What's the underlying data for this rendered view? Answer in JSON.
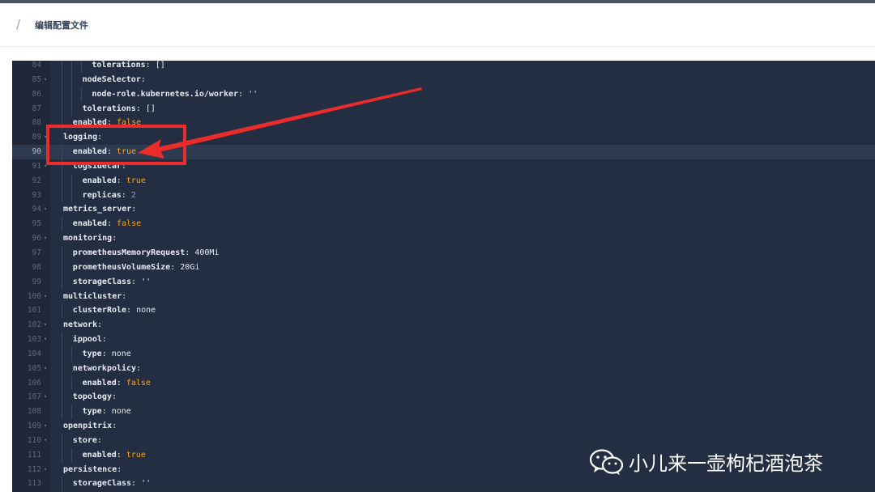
{
  "header": {
    "title": "编辑配置文件"
  },
  "editor": {
    "active_line": 90,
    "lines": [
      {
        "n": "84",
        "fold": false,
        "indent": 3,
        "key": "tolerations",
        "val": "[]",
        "vt": "str"
      },
      {
        "n": "85",
        "fold": true,
        "indent": 2,
        "key": "nodeSelector",
        "val": "",
        "vt": "none"
      },
      {
        "n": "86",
        "fold": false,
        "indent": 3,
        "key": "node-role.kubernetes.io/worker",
        "val": "''",
        "vt": "str"
      },
      {
        "n": "87",
        "fold": false,
        "indent": 2,
        "key": "tolerations",
        "val": "[]",
        "vt": "str"
      },
      {
        "n": "88",
        "fold": false,
        "indent": 1,
        "key": "enabled",
        "val": "false",
        "vt": "bool"
      },
      {
        "n": "89",
        "fold": true,
        "indent": 0,
        "key": "logging",
        "val": "",
        "vt": "none"
      },
      {
        "n": "90",
        "fold": false,
        "indent": 1,
        "key": "enabled",
        "val": "true",
        "vt": "bool"
      },
      {
        "n": "91",
        "fold": true,
        "indent": 1,
        "key": "logsidecar",
        "val": "",
        "vt": "none"
      },
      {
        "n": "92",
        "fold": false,
        "indent": 2,
        "key": "enabled",
        "val": "true",
        "vt": "bool"
      },
      {
        "n": "93",
        "fold": false,
        "indent": 2,
        "key": "replicas",
        "val": "2",
        "vt": "num"
      },
      {
        "n": "94",
        "fold": true,
        "indent": 0,
        "key": "metrics_server",
        "val": "",
        "vt": "none"
      },
      {
        "n": "95",
        "fold": false,
        "indent": 1,
        "key": "enabled",
        "val": "false",
        "vt": "bool"
      },
      {
        "n": "96",
        "fold": true,
        "indent": 0,
        "key": "monitoring",
        "val": "",
        "vt": "none"
      },
      {
        "n": "97",
        "fold": false,
        "indent": 1,
        "key": "prometheusMemoryRequest",
        "val": "400Mi",
        "vt": "str"
      },
      {
        "n": "98",
        "fold": false,
        "indent": 1,
        "key": "prometheusVolumeSize",
        "val": "20Gi",
        "vt": "str"
      },
      {
        "n": "99",
        "fold": false,
        "indent": 1,
        "key": "storageClass",
        "val": "''",
        "vt": "str"
      },
      {
        "n": "100",
        "fold": true,
        "indent": 0,
        "key": "multicluster",
        "val": "",
        "vt": "none"
      },
      {
        "n": "101",
        "fold": false,
        "indent": 1,
        "key": "clusterRole",
        "val": "none",
        "vt": "str"
      },
      {
        "n": "102",
        "fold": true,
        "indent": 0,
        "key": "network",
        "val": "",
        "vt": "none"
      },
      {
        "n": "103",
        "fold": true,
        "indent": 1,
        "key": "ippool",
        "val": "",
        "vt": "none"
      },
      {
        "n": "104",
        "fold": false,
        "indent": 2,
        "key": "type",
        "val": "none",
        "vt": "str"
      },
      {
        "n": "105",
        "fold": true,
        "indent": 1,
        "key": "networkpolicy",
        "val": "",
        "vt": "none"
      },
      {
        "n": "106",
        "fold": false,
        "indent": 2,
        "key": "enabled",
        "val": "false",
        "vt": "bool"
      },
      {
        "n": "107",
        "fold": true,
        "indent": 1,
        "key": "topology",
        "val": "",
        "vt": "none"
      },
      {
        "n": "108",
        "fold": false,
        "indent": 2,
        "key": "type",
        "val": "none",
        "vt": "str"
      },
      {
        "n": "109",
        "fold": true,
        "indent": 0,
        "key": "openpitrix",
        "val": "",
        "vt": "none"
      },
      {
        "n": "110",
        "fold": true,
        "indent": 1,
        "key": "store",
        "val": "",
        "vt": "none"
      },
      {
        "n": "111",
        "fold": false,
        "indent": 2,
        "key": "enabled",
        "val": "true",
        "vt": "bool"
      },
      {
        "n": "112",
        "fold": true,
        "indent": 0,
        "key": "persistence",
        "val": "",
        "vt": "none"
      },
      {
        "n": "113",
        "fold": false,
        "indent": 1,
        "key": "storageClass",
        "val": "''",
        "vt": "str"
      }
    ]
  },
  "watermark": {
    "text": "小儿来一壶枸杞酒泡茶",
    "icon": "wechat-icon"
  },
  "colors": {
    "highlight": "#ec2b2b",
    "editor_bg": "#242e42",
    "bool": "#f5a623",
    "number": "#a78bfa"
  }
}
